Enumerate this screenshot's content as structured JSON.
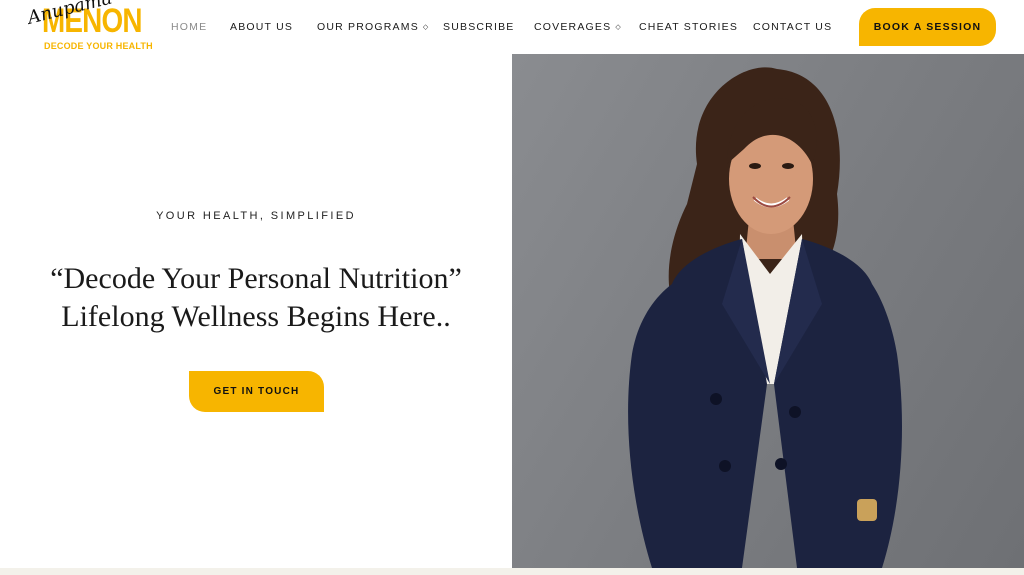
{
  "brand": {
    "name": "MENON",
    "script_name": "Anupama",
    "tagline": "DECODE YOUR HEALTH"
  },
  "nav": {
    "items": [
      {
        "label": "HOME",
        "active": true
      },
      {
        "label": "ABOUT US"
      },
      {
        "label": "OUR PROGRAMS",
        "dropdown": true
      },
      {
        "label": "SUBSCRIBE"
      },
      {
        "label": "COVERAGES",
        "dropdown": true
      },
      {
        "label": "CHEAT STORIES"
      },
      {
        "label": "CONTACT US"
      }
    ],
    "book_label": "BOOK A SESSION"
  },
  "hero": {
    "eyebrow": "YOUR HEALTH, SIMPLIFIED",
    "headline_line1": "“Decode Your Personal Nutrition”",
    "headline_line2": "Lifelong Wellness Begins Here..",
    "cta_label": "GET IN TOUCH"
  },
  "colors": {
    "accent": "#f7b500",
    "text": "#1a1a1a",
    "active_nav": "#8a8a8a",
    "photo_background": "#7d7f83",
    "blazer": "#1c2340"
  }
}
